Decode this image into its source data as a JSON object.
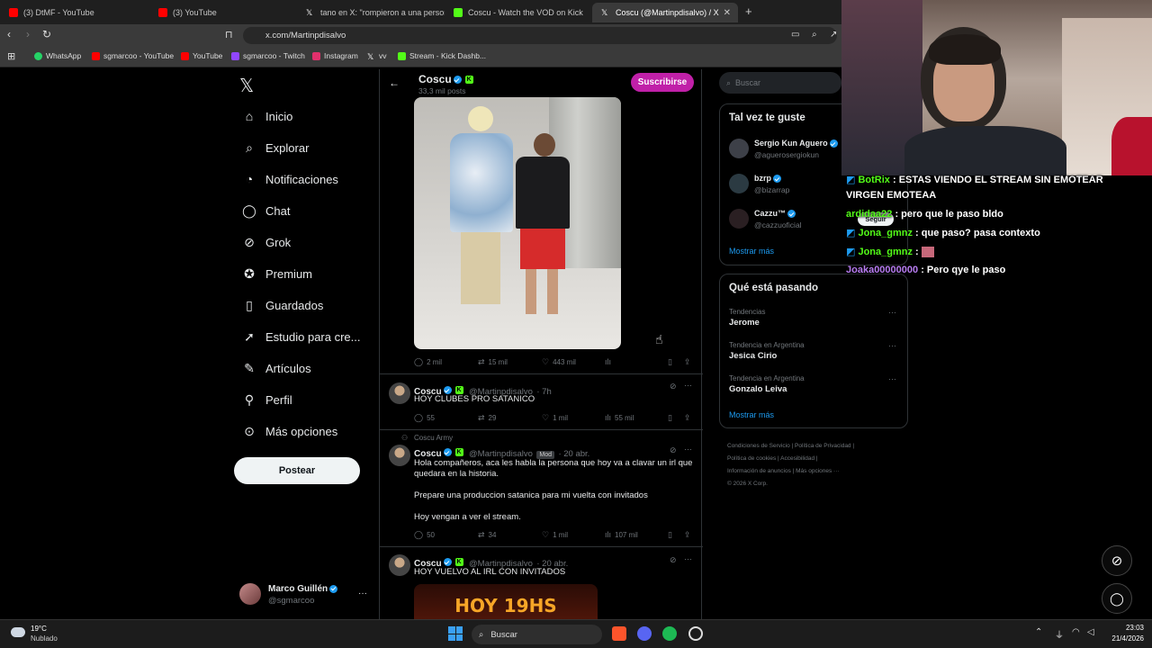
{
  "browser": {
    "tabs": [
      {
        "label": "(3) DtMF - YouTube",
        "color": "#ff0000"
      },
      {
        "label": "(3) YouTube",
        "color": "#ff0000"
      },
      {
        "label": "tano en X: \"rompieron a una persona",
        "color": "#ffffff"
      },
      {
        "label": "Coscu - Watch the VOD on Kick",
        "color": "#53fc18"
      },
      {
        "label": "Coscu (@Martinpdisalvo) / X",
        "color": "#ffffff"
      }
    ],
    "url": "x.com/Martinpdisalvo",
    "bookmarks": [
      "WhatsApp",
      "sgmarcoo - YouTube",
      "YouTube",
      "sgmarcoo - Twitch",
      "Instagram",
      "vv",
      "Stream - Kick Dashb..."
    ]
  },
  "x": {
    "logo": "X",
    "nav": [
      "Inicio",
      "Explorar",
      "Notificaciones",
      "Chat",
      "Grok",
      "Premium",
      "Guardados",
      "Estudio para cre...",
      "Artículos",
      "Perfil",
      "Más opciones"
    ],
    "nav_icons": [
      "home-icon",
      "search-icon",
      "bell-icon",
      "chat-icon",
      "grok-icon",
      "premium-icon",
      "bookmark-icon",
      "rocket-icon",
      "article-icon",
      "profile-icon",
      "more-icon"
    ],
    "post_button": "Postear",
    "account": {
      "name": "Marco Guillén",
      "handle": "@sgmarcoo"
    },
    "header": {
      "name": "Coscu",
      "posts": "33,3 mil posts",
      "subscribe": "Suscribirse"
    },
    "tweets": [
      {
        "replies": "2 mil",
        "retweets": "15 mil",
        "likes": "443 mil",
        "views": ""
      },
      {
        "name": "Coscu",
        "handle": "@Martinpdisalvo",
        "time": "· 7h",
        "text": "HOY CLUBES PRO SATANICO",
        "replies": "55",
        "retweets": "29",
        "likes": "1 mil",
        "views": "55 mil"
      },
      {
        "community": "Coscu Army",
        "name": "Coscu",
        "handle": "@Martinpdisalvo",
        "badge": "Mod",
        "time": "· 20 abr.",
        "text1": "Hola compañeros, aca les habla la persona que hoy va a clavar un irl que",
        "text1b": "quedara en la historia.",
        "text2": "Prepare una produccion satanica para mi vuelta con invitados",
        "text3": "Hoy vengan a ver el stream.",
        "replies": "50",
        "retweets": "34",
        "likes": "1 mil",
        "views": "107 mil"
      },
      {
        "name": "Coscu",
        "handle": "@Martinpdisalvo",
        "time": "· 20 abr.",
        "text": "HOY VUELVO AL IRL CON INVITADOS",
        "image_text": "HOY 19HS"
      }
    ],
    "search_placeholder": "Buscar",
    "who_to_follow": {
      "title": "Tal vez te guste",
      "users": [
        {
          "name": "Sergio Kun Aguero",
          "handle": "@aguerosergiokun"
        },
        {
          "name": "bzrp",
          "handle": "@bizarrap"
        },
        {
          "name": "Cazzu™",
          "handle": "@cazzuoficial"
        }
      ],
      "show_more": "Mostrar más",
      "follow": "Seguir"
    },
    "trends": {
      "title": "Qué está pasando",
      "items": [
        {
          "context": "Tendencias",
          "name": "Jerome"
        },
        {
          "context": "Tendencia en Argentina",
          "name": "Jesica Cirio"
        },
        {
          "context": "Tendencia en Argentina",
          "name": "Gonzalo Leiva"
        }
      ],
      "show_more": "Mostrar más"
    },
    "footer": [
      "Condiciones de Servicio",
      "Política de Privacidad",
      "Política de cookies",
      "Accesibilidad",
      "Información de anuncios",
      "Más opciones ···",
      "© 2026 X Corp."
    ]
  },
  "chat": [
    {
      "user": "BotRix",
      "text": ": ESTAS VIENDO EL STREAM SIN EMOTEAR",
      "text2": "VIRGEN EMOTEAA",
      "color": "#53fc18"
    },
    {
      "user": "ardidaa22",
      "text": ": pero que le paso bldo",
      "color": "#53fc18"
    },
    {
      "user": "Jona_gmnz",
      "text": ": que paso? pasa contexto",
      "color": "#53fc18"
    },
    {
      "user": "Jona_gmnz",
      "text": ":",
      "color": "#53fc18"
    },
    {
      "user": "Joaka00000000",
      "text": ": Pero qye le paso",
      "color": "#b77cf0"
    }
  ],
  "taskbar": {
    "temp": "19°C",
    "weather": "Nublado",
    "search": "Buscar",
    "time": "23:03",
    "date": "21/4/2026"
  }
}
